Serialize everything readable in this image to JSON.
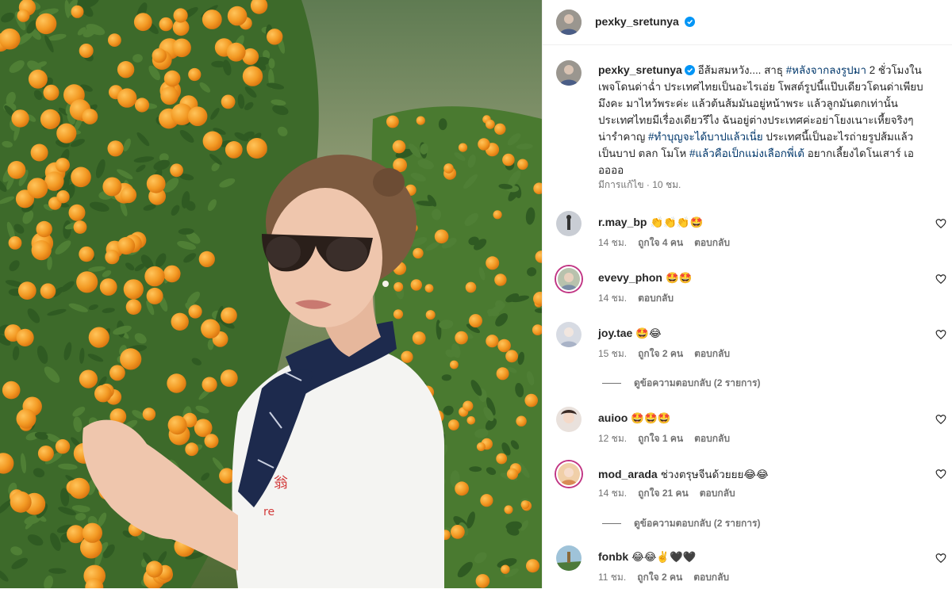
{
  "post": {
    "username": "pexky_sretunya",
    "verified": true,
    "caption_prefix": "อีส้มสมหวัง.... สาธุ ",
    "caption_tag1": "#หลังจากลงรูปมา",
    "caption_mid": " 2 ชั่วโมงในเพจโดนด่าฉ่ำ ประเทศไทยเป็นอะไรเอ่ย โพสต์รูปนี้แป๊บเดียวโดนด่าเพียบ มึงคะ มาไหว้พระค่ะ แล้วต้นส้มมันอยู่หน้าพระ แล้วลูกมันตกเท่านั้น ประเทศไทยมีเรื่องเดียวรึไง ฉันอยู่ต่างประเทศค่ะอย่าโยงเนาะเหี้ยจริงๆน่ารำคาญ ",
    "caption_tag2": "#ทำบุญจะได้บาปแล้วเนี่ย",
    "caption_mid2": " ประเทศนี้เป็นอะไรถ่ายรูปส้มแล้วเป็นบาป ตลก โมโห ",
    "caption_tag3": "#แล้วคือเป็กแม่งเลือกพี่เต้",
    "caption_suffix": " อยากเลี้ยงไดโนเสาร์ เอออออ",
    "edited_label": "มีการแก้ไข · 10 ชม."
  },
  "comments": [
    {
      "username": "r.may_bp",
      "text": "👏👏👏🤩",
      "time": "14 ชม.",
      "likes": "ถูกใจ 4 คน",
      "reply": "ตอบกลับ",
      "ring": false
    },
    {
      "username": "evevy_phon",
      "text": "🤩🤩",
      "time": "14 ชม.",
      "likes": "",
      "reply": "ตอบกลับ",
      "ring": true
    },
    {
      "username": "joy.tae",
      "text": "🤩😂",
      "time": "15 ชม.",
      "likes": "ถูกใจ 2 คน",
      "reply": "ตอบกลับ",
      "ring": false,
      "view_replies": "ดูข้อความตอบกลับ (2 รายการ)"
    },
    {
      "username": "auioo",
      "text": "🤩🤩🤩",
      "time": "12 ชม.",
      "likes": "ถูกใจ 1 คน",
      "reply": "ตอบกลับ",
      "ring": false
    },
    {
      "username": "mod_arada",
      "text": "ช่วงตรุษจีนด้วยยย😂😂",
      "time": "14 ชม.",
      "likes": "ถูกใจ 21 คน",
      "reply": "ตอบกลับ",
      "ring": true,
      "view_replies": "ดูข้อความตอบกลับ (2 รายการ)"
    },
    {
      "username": "fonbk",
      "text": "😂😂✌️🖤🖤",
      "time": "11 ชม.",
      "likes": "ถูกใจ 2 คน",
      "reply": "ตอบกลับ",
      "ring": false
    }
  ],
  "colors": {
    "verified": "#0095f6",
    "hashtag": "#00376b",
    "muted": "#737373",
    "orange": "#f39a24",
    "leaf": "#2f5a22"
  },
  "icons": {
    "verified": "verified-badge-icon",
    "like": "heart-icon"
  }
}
